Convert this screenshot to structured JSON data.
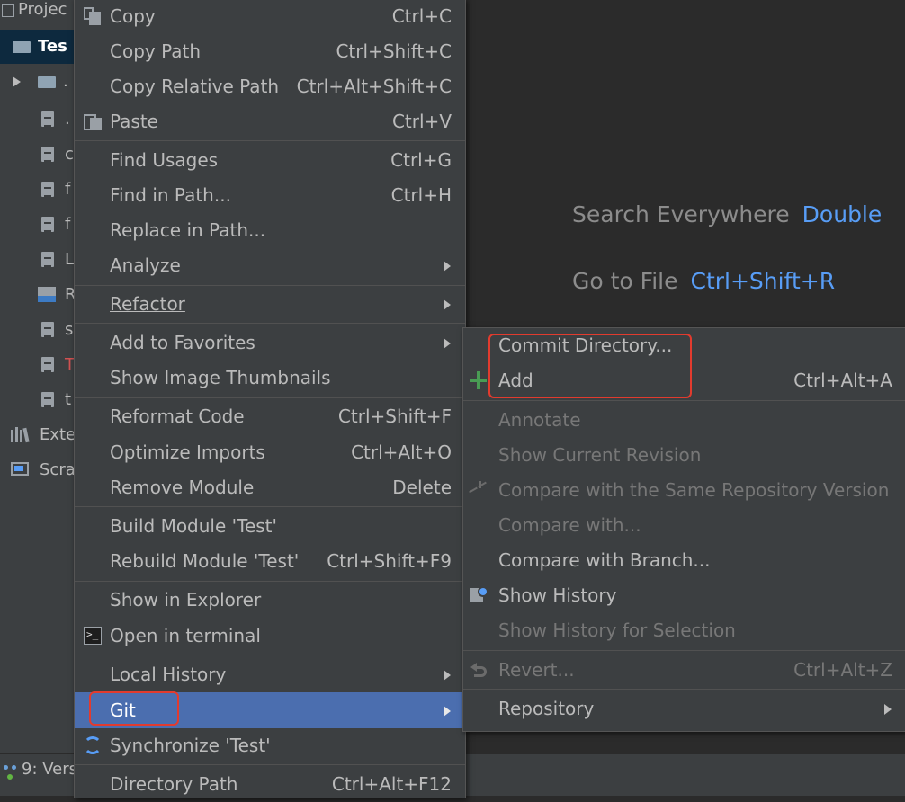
{
  "project_panel": {
    "items": [
      {
        "icon": "project-icon",
        "text": "Projec"
      },
      {
        "icon": "folder-icon",
        "text": "Tes"
      },
      {
        "icon": "folder-icon",
        "text": "."
      },
      {
        "icon": "file-icon",
        "text": "."
      },
      {
        "icon": "file-icon",
        "text": "c"
      },
      {
        "icon": "file-icon",
        "text": "f"
      },
      {
        "icon": "file-icon",
        "text": "f"
      },
      {
        "icon": "file-icon",
        "text": "L"
      },
      {
        "icon": "markdown-file-icon",
        "text": "R"
      },
      {
        "icon": "file-icon",
        "text": "s"
      },
      {
        "icon": "file-icon",
        "text": "T"
      },
      {
        "icon": "file-icon",
        "text": "t"
      },
      {
        "icon": "libraries-icon",
        "text": "Exte"
      },
      {
        "icon": "scratches-icon",
        "text": "Scra"
      }
    ],
    "version_control_tab": "9: Vers"
  },
  "editor": {
    "search_everywhere_label": "Search Everywhere",
    "search_everywhere_key": "Double",
    "go_to_file_label": "Go to File",
    "go_to_file_key": "Ctrl+Shift+R"
  },
  "context_menu": {
    "copy": {
      "label": "Copy",
      "shortcut": "Ctrl+C"
    },
    "copy_path": {
      "label": "Copy Path",
      "shortcut": "Ctrl+Shift+C"
    },
    "copy_relative_path": {
      "label": "Copy Relative Path",
      "shortcut": "Ctrl+Alt+Shift+C"
    },
    "paste": {
      "label": "Paste",
      "shortcut": "Ctrl+V"
    },
    "find_usages": {
      "label": "Find Usages",
      "shortcut": "Ctrl+G"
    },
    "find_in_path": {
      "label": "Find in Path...",
      "shortcut": "Ctrl+H"
    },
    "replace_in_path": {
      "label": "Replace in Path..."
    },
    "analyze": {
      "label": "Analyze"
    },
    "refactor": {
      "label": "Refactor"
    },
    "add_to_favorites": {
      "label": "Add to Favorites"
    },
    "show_image_thumbnails": {
      "label": "Show Image Thumbnails"
    },
    "reformat_code": {
      "label": "Reformat Code",
      "shortcut": "Ctrl+Shift+F"
    },
    "optimize_imports": {
      "label": "Optimize Imports",
      "shortcut": "Ctrl+Alt+O"
    },
    "remove_module": {
      "label": "Remove Module",
      "shortcut": "Delete"
    },
    "build_module": {
      "label": "Build Module 'Test'"
    },
    "rebuild_module": {
      "label": "Rebuild Module 'Test'",
      "shortcut": "Ctrl+Shift+F9"
    },
    "show_in_explorer": {
      "label": "Show in Explorer"
    },
    "open_in_terminal": {
      "label": "Open in terminal"
    },
    "local_history": {
      "label": "Local History"
    },
    "git": {
      "label": "Git"
    },
    "synchronize": {
      "label": "Synchronize 'Test'"
    },
    "directory_path": {
      "label": "Directory Path",
      "shortcut": "Ctrl+Alt+F12"
    }
  },
  "git_submenu": {
    "commit_directory": {
      "label": "Commit Directory..."
    },
    "add": {
      "label": "Add",
      "shortcut": "Ctrl+Alt+A"
    },
    "annotate": {
      "label": "Annotate"
    },
    "show_current_revision": {
      "label": "Show Current Revision"
    },
    "compare_same_repo": {
      "label": "Compare with the Same Repository Version"
    },
    "compare_with": {
      "label": "Compare with..."
    },
    "compare_with_branch": {
      "label": "Compare with Branch..."
    },
    "show_history": {
      "label": "Show History"
    },
    "show_history_selection": {
      "label": "Show History for Selection"
    },
    "revert": {
      "label": "Revert...",
      "shortcut": "Ctrl+Alt+Z"
    },
    "repository": {
      "label": "Repository"
    }
  },
  "colors": {
    "menu_bg": "#3c3f41",
    "selection": "#4b6eaf",
    "link_blue": "#589df6",
    "annotation_red": "#e23b2e",
    "add_green": "#499c54"
  }
}
